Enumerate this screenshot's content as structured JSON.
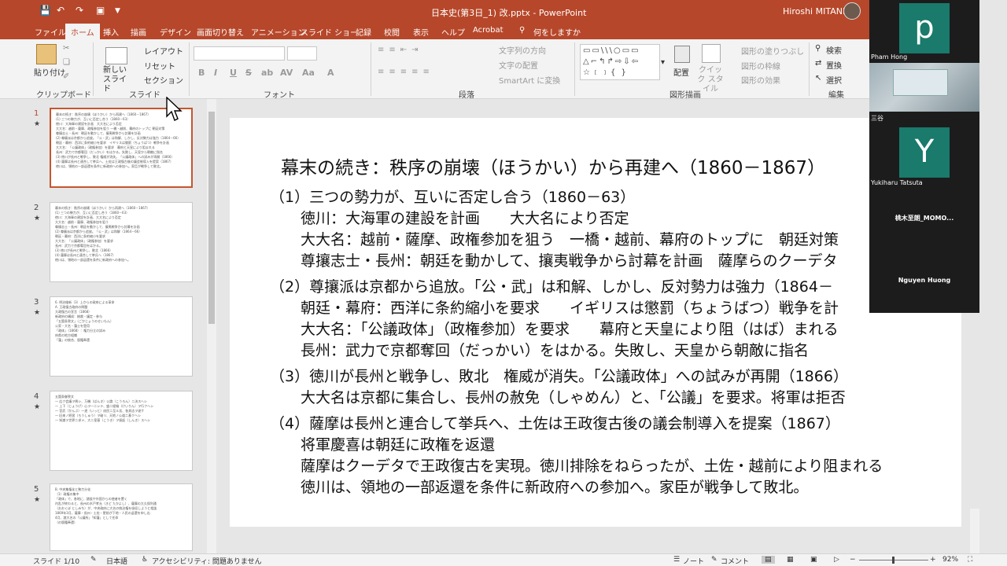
{
  "app": {
    "window_title": "日本史(第3日_1) 改.pptx  -  PowerPoint",
    "user_name": "Hiroshi MITANI"
  },
  "tabs": [
    "ファイル",
    "ホーム",
    "挿入",
    "描画",
    "デザイン",
    "画面切り替え",
    "アニメーション",
    "スライド ショー",
    "記録",
    "校閲",
    "表示",
    "ヘルプ",
    "Acrobat",
    "何をしますか"
  ],
  "ribbon": {
    "clipboard": {
      "paste": "貼り付け",
      "label": "クリップボード"
    },
    "slides": {
      "new_slide": "新しい スライド",
      "layout": "レイアウト",
      "reset": "リセット",
      "section": "セクション",
      "label": "スライド"
    },
    "font": {
      "label": "フォント",
      "buttons": [
        "B",
        "I",
        "U",
        "S",
        "ab",
        "AV",
        "Aa",
        "A"
      ]
    },
    "paragraph": {
      "text_direction": "文字列の方向",
      "align_text": "文字の配置",
      "smartart": "SmartArt に変換",
      "label": "段落"
    },
    "drawing": {
      "arrange": "配置",
      "quick_styles": "クイック スタイル",
      "fill": "図形の塗りつぶし",
      "outline": "図形の枠線",
      "effects": "図形の効果",
      "label": "図形描画"
    },
    "editing": {
      "find": "検索",
      "replace": "置換",
      "select": "選択",
      "label": "編集"
    }
  },
  "thumbnails": [
    {
      "num": "1",
      "lines": [
        "幕末の続き：秩序の崩壊（ほうかい）から再建へ（1860－1867）",
        "(1) 三つの勢力が、互いに否定し合う（1860－63）",
        "徳川：大海軍の建設を計画　大大名により否定",
        "大大名：越前・薩摩、政権参加を狙う 一橋・越前、幕府のトップに 朝廷対策",
        "尊攘志士・長州：朝廷を動かして、攘夷戦争から討幕を計画",
        "(2) 尊攘派は京都から追放。「公・武」は和解、しかし、反対勢力は強力（1864－66）",
        "朝廷・幕府：西洋に条約縮小を要求　イギリスは懲罰（ちょうばつ）戦争を計画",
        "大大名：「公議政体」（政権参加）を要求　幕府と天皇により阻まれる",
        "長州：武力で京都奪回（だっかい）をはかる。失敗し、天皇から朝敵に指名",
        "(3) 徳川が長州と戦争し、敗北 権威が消失。「公議政体」への試みが再開（1866）",
        "(4) 薩摩は長州と連合して挙兵へ、土佐は王政復古後の議会制導入を提案（1867）",
        "徳川は、領地の一部返還を条件に新政府への参加へ。家臣が戦争して敗北。"
      ]
    },
    {
      "num": "2",
      "lines": [
        "幕末の続き：秩序の崩壊（ほうかい）から再建へ（1860－1867）",
        "(1) 三つの勢力が、互いに否定し合う（1860－63）",
        "徳川：大海軍の建設を計画、大大名により否定",
        "大大名：越前・薩摩、政権参加を狙う",
        "尊攘志士・長州：朝廷を動かして、攘夷戦争から討幕を計画",
        "(2) 尊攘派は京都から追放。「公・武」は和解（1864－66）",
        "朝廷・幕府：西洋に条約縮小を要求",
        "大大名：「公議政体」（政権参加）を要求",
        "長州：武力で京都奪回をはかる。",
        "(3) 徳川が長州と戦争し、敗北（1866）",
        "(4) 薩摩は長州と連合して挙兵へ（1867）",
        "徳川は、領地の一部返還を条件に新政府への参加へ。"
      ]
    },
    {
      "num": "3",
      "lines": [
        "6. 明治維新（3）上からの政府による革命",
        "A. 王政復古政府の問題",
        "大政復古の宣言（1868）",
        "新政府の構成：総裁・議定・参与",
        "「五箇条誓文」（ごかじょうのせいもん）",
        "公家・大名・藩士を登用",
        "「政体」（1868）：権力分立の試み",
        "府県の地方組織",
        "「藩」の統合、版籍奉還"
      ]
    },
    {
      "num": "4",
      "lines": [
        "五箇条御誓文",
        "一 広ク会議ヲ興シ、万機（ばんき）公論（こうろん）ニ決スヘシ",
        "一 上下（じょうげ）心ヲ一ニシテ、盛ニ経綸（けいりん）ヲ行フヘシ",
        "一 官武（かんぶ）一途（いっと）庶民ニ至ル迄、各其志ヲ遂ケ",
        "一 旧来ノ陋習（ろうしゅう）ヲ破リ、天地ノ公道ニ基クヘシ",
        "一 知識ヲ世界ニ求メ、大ニ皇基（こうき）ヲ振起（しんき）スヘシ"
      ]
    },
    {
      "num": "5",
      "lines": [
        "B. 中央集権化と勢力分化",
        "（1）政権の集中",
        "「政体」で、各地に、諸侯や外国からの使者を置く",
        "内乱が終わると、長州の木戸孝允（きど たかよし）、薩摩の大久保利通",
        "（おおくぼ としみち）が、中央政府に大名の統治権を吸収しようと相談",
        "1869年3月、薩摩・長州・土佐・肥前が下地・人民の返還を申し出",
        "4月、諸大名の「公議所」「知藩」として任命",
        "（の版籍奉還）"
      ]
    }
  ],
  "slide": {
    "title": "幕末の続き：秩序の崩壊（ほうかい）から再建へ（1860－1867）",
    "lines": [
      "（1）三つの勢力が、互いに否定し合う（1860－63）",
      "徳川：大海軍の建設を計画　　大大名により否定",
      "大大名：越前・薩摩、政権参加を狙う　一橋・越前、幕府のトップに　朝廷対策",
      "尊攘志士・長州：朝廷を動かして、攘夷戦争から討幕を計画　薩摩らのクーデタ",
      "（2）尊攘派は京都から追放。「公・武」は和解、しかし、反対勢力は強力（1864－",
      "朝廷・幕府：西洋に条約縮小を要求　　イギリスは懲罰（ちょうばつ）戦争を計",
      "大大名：「公議政体」（政権参加）を要求　　幕府と天皇により阻（はば）まれる",
      "長州：武力で京都奪回（だっかい）をはかる。失敗し、天皇から朝敵に指名",
      "（3）徳川が長州と戦争し、敗北　権威が消失。「公議政体」への試みが再開（1866）",
      "大大名は京都に集合し、長州の赦免（しゃめん）と、「公議」を要求。将軍は拒否",
      "（4）薩摩は長州と連合して挙兵へ、土佐は王政復古後の議会制導入を提案（1867）",
      "将軍慶喜は朝廷に政権を返還",
      "薩摩はクーデタで王政復古を実現。徳川排除をねらったが、土佐・越前により阻まれる",
      "徳川は、領地の一部返還を条件に新政府への参加へ。家臣が戦争して敗北。"
    ]
  },
  "status": {
    "slide_info": "スライド 1/10",
    "language": "日本語",
    "accessibility": "アクセシビリティ: 問題ありません",
    "notes": "ノート",
    "comments": "コメント",
    "zoom": "92%"
  },
  "video": {
    "participants": [
      {
        "name": "Pham Hong",
        "initial": "p"
      },
      {
        "name": "三谷",
        "initial": ""
      },
      {
        "name": "Yukiharu Tatsuta",
        "initial": "Y"
      },
      {
        "name": "桃木至朗_MOMO...",
        "initial": ""
      },
      {
        "name": "Nguyen Huong",
        "initial": ""
      }
    ]
  },
  "colors": {
    "accent": "#b7472a",
    "ribbon_bg": "#f3f3f3",
    "avatar_teal": "#1a7a6b"
  },
  "icons": [
    "save-icon",
    "undo-icon",
    "redo-icon",
    "present-icon",
    "search-icon",
    "mouse-cursor-icon"
  ]
}
